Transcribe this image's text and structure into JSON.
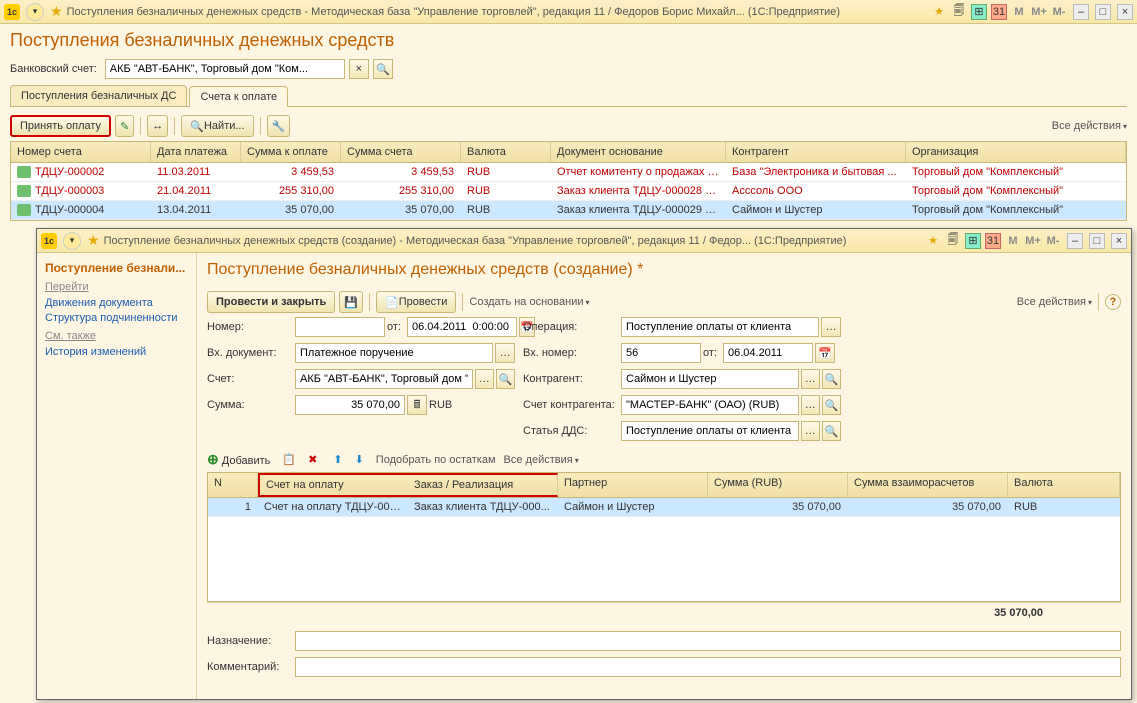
{
  "win1": {
    "title": "Поступления безналичных денежных средств - Методическая база \"Управление торговлей\", редакция 11 / Федоров Борис Михайл...   (1С:Предприятие)",
    "page_title": "Поступления безналичных денежных средств",
    "bank_label": "Банковский счет:",
    "bank_value": "АКБ \"АВТ-БАНК\", Торговый дом \"Ком...",
    "tabs": [
      "Поступления безналичных ДС",
      "Счета к оплате"
    ],
    "btn_accept": "Принять оплату",
    "btn_find": "Найти...",
    "all_actions": "Все действия",
    "cols": [
      "Номер счета",
      "Дата платежа",
      "Сумма к оплате",
      "Сумма счета",
      "Валюта",
      "Документ основание",
      "Контрагент",
      "Организация"
    ],
    "rows": [
      {
        "num": "ТДЦУ-000002",
        "date": "11.03.2011",
        "amt": "3 459,53",
        "sum": "3 459,53",
        "cur": "RUB",
        "doc": "Отчет комитенту о продажах Т...",
        "ctr": "База \"Электроника и бытовая ...",
        "org": "Торговый дом \"Комплексный\"",
        "red": true
      },
      {
        "num": "ТДЦУ-000003",
        "date": "21.04.2011",
        "amt": "255 310,00",
        "sum": "255 310,00",
        "cur": "RUB",
        "doc": "Заказ клиента ТДЦУ-000028 о...",
        "ctr": "Асссоль ООО",
        "org": "Торговый дом \"Комплексный\"",
        "red": true
      },
      {
        "num": "ТДЦУ-000004",
        "date": "13.04.2011",
        "amt": "35 070,00",
        "sum": "35 070,00",
        "cur": "RUB",
        "doc": "Заказ клиента ТДЦУ-000029 о...",
        "ctr": "Саймон и Шустер",
        "org": "Торговый дом \"Комплексный\"",
        "sel": true
      }
    ]
  },
  "win2": {
    "title": "Поступление безналичных денежных средств (создание) - Методическая база \"Управление торговлей\", редакция 11 / Федор...   (1С:Предприятие)",
    "nav_title": "Поступление безнали...",
    "nav_goto": "Перейти",
    "nav_links1": [
      "Движения документа",
      "Структура подчиненности"
    ],
    "nav_see": "См. также",
    "nav_links2": [
      "История изменений"
    ],
    "page_title": "Поступление безналичных денежных средств (создание) *",
    "btn_post_close": "Провести и закрыть",
    "btn_post": "Провести",
    "btn_create_based": "Создать на основании",
    "all_actions": "Все действия",
    "labels": {
      "number": "Номер:",
      "from": "от:",
      "operation": "Операция:",
      "in_doc": "Вх. документ:",
      "in_num": "Вх. номер:",
      "account": "Счет:",
      "counterparty": "Контрагент:",
      "amount": "Сумма:",
      "ctr_account": "Счет контрагента:",
      "dds": "Статья ДДС:",
      "purpose": "Назначение:",
      "comment": "Комментарий:"
    },
    "values": {
      "number": "",
      "date": "06.04.2011  0:00:00",
      "operation": "Поступление оплаты от клиента",
      "in_doc": "Платежное поручение",
      "in_num": "56",
      "in_date": "06.04.2011",
      "account": "АКБ \"АВТ-БАНК\", Торговый дом \"Ком...",
      "counterparty": "Саймон и Шустер",
      "amount": "35 070,00",
      "currency": "RUB",
      "ctr_account": "\"МАСТЕР-БАНК\" (ОАО) (RUB)",
      "dds": "Поступление оплаты от клиента",
      "purpose": "",
      "comment": ""
    },
    "btn_add": "Добавить",
    "btn_pick": "Подобрать по остаткам",
    "sub_cols": [
      "N",
      "Счет на оплату",
      "Заказ / Реализация",
      "Партнер",
      "Сумма (RUB)",
      "Сумма взаиморасчетов",
      "Валюта"
    ],
    "sub_row": {
      "n": "1",
      "acc": "Счет на оплату ТДЦУ-000...",
      "order": "Заказ клиента ТДЦУ-000...",
      "partner": "Саймон и Шустер",
      "sum": "35 070,00",
      "sum2": "35 070,00",
      "cur": "RUB"
    },
    "total": "35 070,00"
  }
}
